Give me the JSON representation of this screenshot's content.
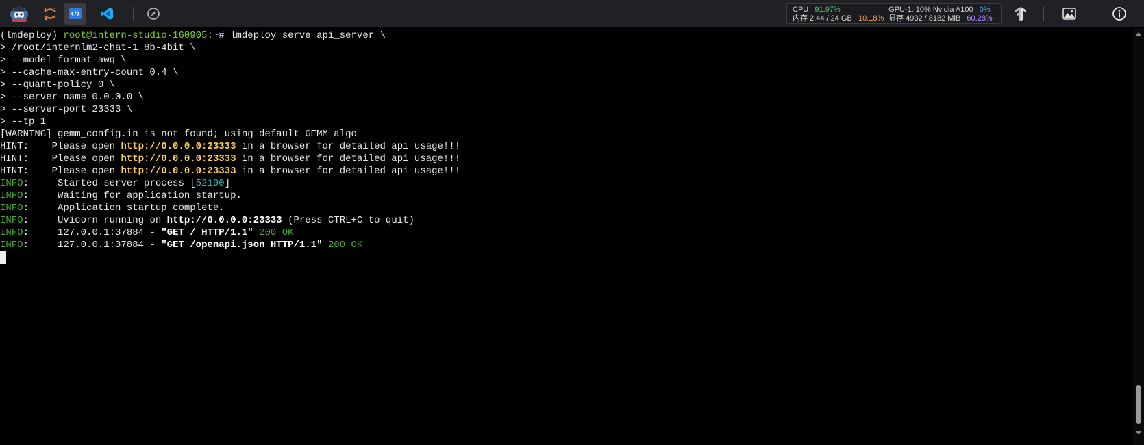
{
  "topbar": {
    "stats": {
      "cpu_label": "CPU",
      "cpu_value": "91.97%",
      "gpu_label": "GPU-1: 10% Nvidia A100",
      "gpu_value": "0%",
      "mem_label": "内存 2.44 / 24 GB",
      "mem_value": "10.18%",
      "vram_label": "显存 4932 / 8182 MiB",
      "vram_value": "60.28%"
    }
  },
  "terminal": {
    "prompt_env": "(lmdeploy) ",
    "prompt_user": "root@intern-studio-160905",
    "prompt_colon": ":",
    "prompt_tilde": "~",
    "prompt_cmd": "# lmdeploy serve api_server \\",
    "cont_lines": [
      "> /root/internlm2-chat-1_8b-4bit \\",
      "> --model-format awq \\",
      "> --cache-max-entry-count 0.4 \\",
      "> --quant-policy 0 \\",
      "> --server-name 0.0.0.0 \\",
      "> --server-port 23333 \\",
      "> --tp 1"
    ],
    "warning": "[WARNING] gemm_config.in is not found; using default GEMM algo",
    "hint_prefix": "HINT:    Please open ",
    "hint_url": "http://0.0.0.0:23333",
    "hint_suffix": " in a browser for detailed api usage!!!",
    "info_label": "INFO",
    "info_colon": ":     ",
    "info_started_pre": "Started server process [",
    "info_pid": "52190",
    "info_started_post": "]",
    "info_waiting": "Waiting for application startup.",
    "info_complete": "Application startup complete.",
    "info_uvicorn_pre": "Uvicorn running on ",
    "info_uvicorn_url": "http://0.0.0.0:23333",
    "info_uvicorn_post": " (Press CTRL+C to quit)",
    "access_addr": "127.0.0.1:37884 - ",
    "access1_req": "\"GET / HTTP/1.1\"",
    "access2_req": "\"GET /openapi.json HTTP/1.1\"",
    "access_status": " 200 OK"
  },
  "colors": {
    "background": "#000000",
    "topbar": "#202124",
    "prompt_user": "#7ed321",
    "url": "#ffd24d",
    "info": "#46a92f"
  }
}
